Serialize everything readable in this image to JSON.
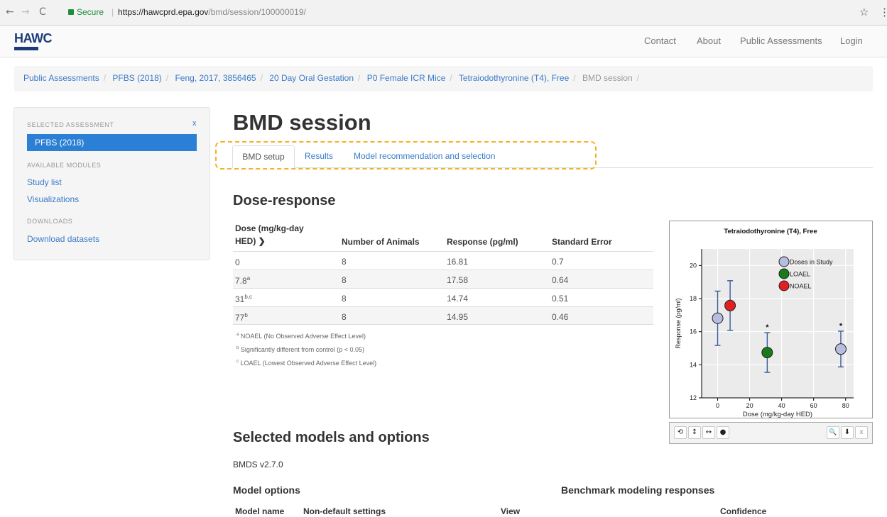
{
  "browser": {
    "secure_label": "Secure",
    "url_base": "https://hawcprd.epa.gov",
    "url_path": "/bmd/session/100000019/"
  },
  "header": {
    "logo": "HAWC",
    "nav": [
      "Contact",
      "About",
      "Public Assessments",
      "Login"
    ]
  },
  "breadcrumb": {
    "links": [
      "Public Assessments",
      "PFBS (2018)",
      "Feng, 2017, 3856465",
      "20 Day Oral Gestation",
      "P0 Female ICR Mice",
      "Tetraiodothyronine (T4), Free"
    ],
    "current": "BMD session"
  },
  "sidebar": {
    "selected_header": "SELECTED ASSESSMENT",
    "close": "x",
    "selected": "PFBS (2018)",
    "modules_header": "AVAILABLE MODULES",
    "modules": [
      "Study list",
      "Visualizations"
    ],
    "downloads_header": "DOWNLOADS",
    "downloads": [
      "Download datasets"
    ]
  },
  "page": {
    "title": "BMD session",
    "tabs": [
      "BMD setup",
      "Results",
      "Model recommendation and selection"
    ]
  },
  "dose_response": {
    "heading": "Dose-response",
    "headers": [
      "Dose (mg/kg-day",
      "HED) ❯",
      "Number of Animals",
      "Response (pg/ml)",
      "Standard Error"
    ],
    "rows": [
      {
        "dose": "0",
        "sup": "",
        "n": "8",
        "response": "16.81",
        "se": "0.7"
      },
      {
        "dose": "7.8",
        "sup": "a",
        "n": "8",
        "response": "17.58",
        "se": "0.64"
      },
      {
        "dose": "31",
        "sup": "b,c",
        "n": "8",
        "response": "14.74",
        "se": "0.51"
      },
      {
        "dose": "77",
        "sup": "b",
        "n": "8",
        "response": "14.95",
        "se": "0.46"
      }
    ],
    "footnotes": [
      {
        "mark": "a",
        "text": "NOAEL (No Observed Adverse Effect Level)"
      },
      {
        "mark": "b",
        "text": "Significantly different from control (p < 0.05)"
      },
      {
        "mark": "c",
        "text": "LOAEL (Lowest Observed Adverse Effect Level)"
      }
    ]
  },
  "selected_models": {
    "heading": "Selected models and options",
    "version": "BMDS v2.7.0",
    "model_options": "Model options",
    "bmr": "Benchmark modeling responses",
    "cols": [
      "Model name",
      "Non-default settings",
      "View",
      "Confidence"
    ]
  },
  "chart_data": {
    "type": "scatter",
    "title": "Tetraiodothyronine (T4), Free",
    "xlabel": "Dose (mg/kg-day HED)",
    "ylabel": "Response (pg/ml)",
    "xlim": [
      -10,
      85
    ],
    "ylim": [
      12,
      21
    ],
    "xticks": [
      0,
      20,
      40,
      60,
      80
    ],
    "yticks": [
      12,
      14,
      16,
      18,
      20
    ],
    "grid": true,
    "legend_position": "top-right",
    "legend": [
      {
        "name": "Doses in Study",
        "color": "#b8bde0"
      },
      {
        "name": "LOAEL",
        "color": "#1a7a1a"
      },
      {
        "name": "NOAEL",
        "color": "#e02020"
      }
    ],
    "points": [
      {
        "x": 0,
        "y": 16.81,
        "err": 1.64,
        "kind": "Doses in Study",
        "color": "#b8bde0",
        "sig": false
      },
      {
        "x": 7.8,
        "y": 17.58,
        "err": 1.5,
        "kind": "NOAEL",
        "color": "#e02020",
        "sig": false
      },
      {
        "x": 31,
        "y": 14.74,
        "err": 1.2,
        "kind": "LOAEL",
        "color": "#1a7a1a",
        "sig": true
      },
      {
        "x": 77,
        "y": 14.95,
        "err": 1.08,
        "kind": "Doses in Study",
        "color": "#b8bde0",
        "sig": true
      }
    ],
    "sig_marker": "*"
  },
  "toolbar": {
    "icons": [
      "reset-icon",
      "y-zoom-icon",
      "x-zoom-icon",
      "dot-icon",
      "zoom-icon",
      "download-icon",
      "close-icon"
    ],
    "glyphs": [
      "⟲",
      "↕",
      "↔",
      "●",
      "🔍",
      "⬇",
      "x"
    ]
  }
}
